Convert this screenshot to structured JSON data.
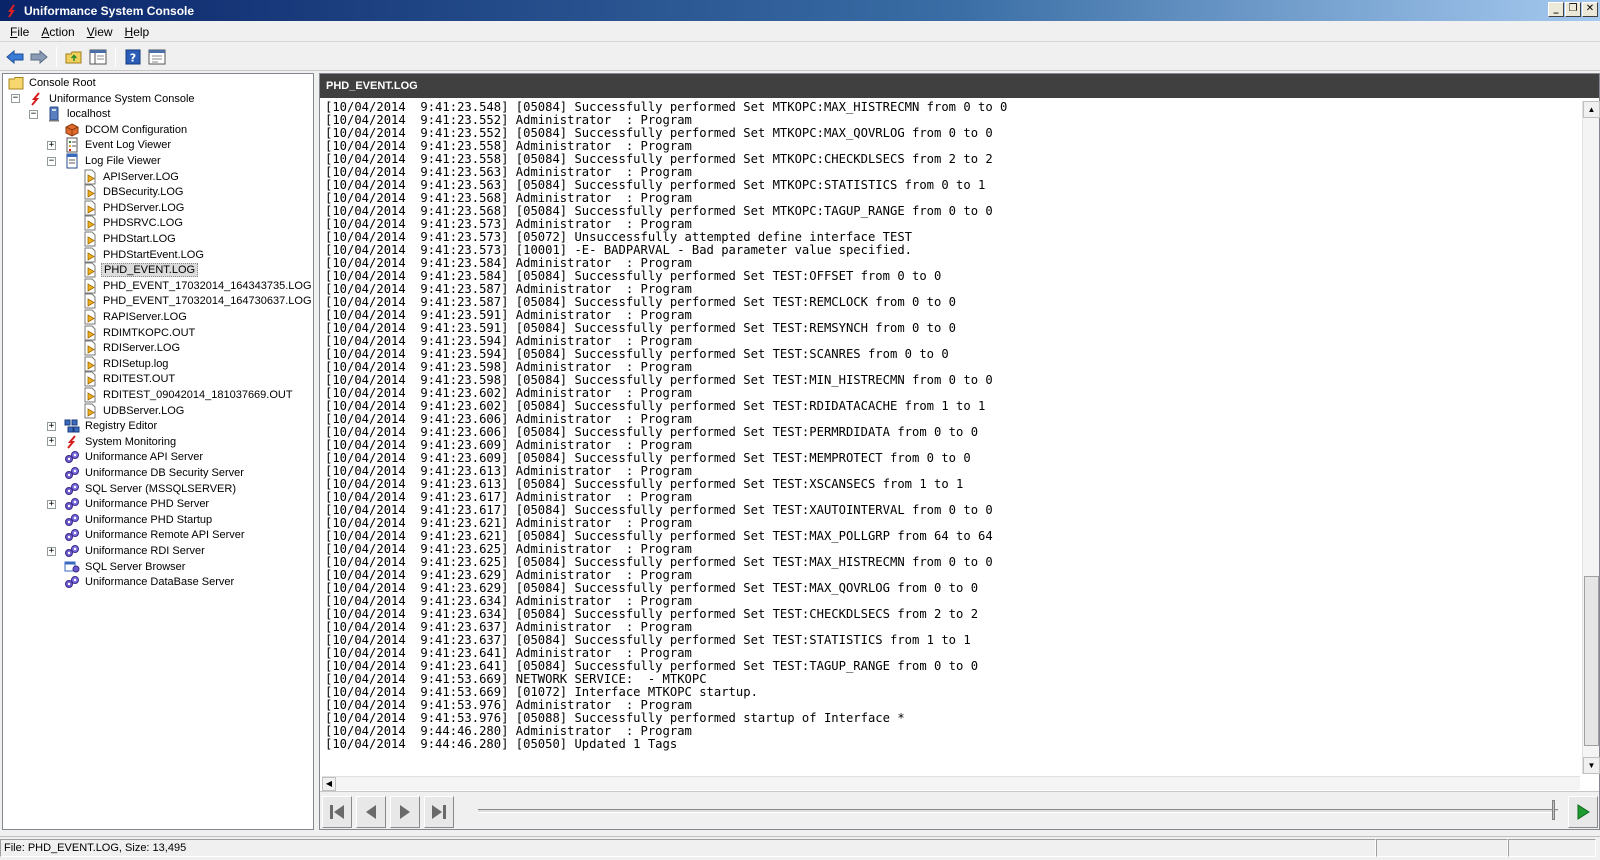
{
  "window": {
    "title": "Uniformance System Console",
    "controls": {
      "minimize": "_",
      "restore": "❐",
      "close": "✕"
    }
  },
  "menu": [
    {
      "label": "File",
      "mnemonic": "F",
      "rest": "ile"
    },
    {
      "label": "Action",
      "mnemonic": "A",
      "rest": "ction"
    },
    {
      "label": "View",
      "mnemonic": "V",
      "rest": "iew"
    },
    {
      "label": "Help",
      "mnemonic": "H",
      "rest": "elp"
    }
  ],
  "toolbar": [
    "back-icon",
    "forward-icon",
    "up-folder-icon",
    "show-hide-tree-icon",
    "help-icon",
    "properties-icon"
  ],
  "tree": [
    {
      "label": "Console Root",
      "icon": "folder-icon",
      "level": 0,
      "expander": ""
    },
    {
      "label": "Uniformance System Console",
      "icon": "uniformance-icon",
      "level": 1,
      "expander": "−"
    },
    {
      "label": "localhost",
      "icon": "computer-icon",
      "level": 2,
      "expander": "−"
    },
    {
      "label": "DCOM Configuration",
      "icon": "dcom-icon",
      "level": 3,
      "expander": ""
    },
    {
      "label": "Event Log Viewer",
      "icon": "event-log-icon",
      "level": 3,
      "expander": "+"
    },
    {
      "label": "Log File Viewer",
      "icon": "log-viewer-icon",
      "level": 3,
      "expander": "−"
    },
    {
      "label": "APIServer.LOG",
      "icon": "log-file-icon",
      "level": 4,
      "expander": ""
    },
    {
      "label": "DBSecurity.LOG",
      "icon": "log-file-icon",
      "level": 4,
      "expander": ""
    },
    {
      "label": "PHDServer.LOG",
      "icon": "log-file-icon",
      "level": 4,
      "expander": ""
    },
    {
      "label": "PHDSRVC.LOG",
      "icon": "log-file-icon",
      "level": 4,
      "expander": ""
    },
    {
      "label": "PHDStart.LOG",
      "icon": "log-file-icon",
      "level": 4,
      "expander": ""
    },
    {
      "label": "PHDStartEvent.LOG",
      "icon": "log-file-icon",
      "level": 4,
      "expander": ""
    },
    {
      "label": "PHD_EVENT.LOG",
      "icon": "log-file-icon",
      "level": 4,
      "expander": "",
      "selected": true
    },
    {
      "label": "PHD_EVENT_17032014_164343735.LOG",
      "icon": "log-file-icon",
      "level": 4,
      "expander": ""
    },
    {
      "label": "PHD_EVENT_17032014_164730637.LOG",
      "icon": "log-file-icon",
      "level": 4,
      "expander": ""
    },
    {
      "label": "RAPIServer.LOG",
      "icon": "log-file-icon",
      "level": 4,
      "expander": ""
    },
    {
      "label": "RDIMTKOPC.OUT",
      "icon": "log-file-icon",
      "level": 4,
      "expander": ""
    },
    {
      "label": "RDIServer.LOG",
      "icon": "log-file-icon",
      "level": 4,
      "expander": ""
    },
    {
      "label": "RDISetup.log",
      "icon": "log-file-icon",
      "level": 4,
      "expander": ""
    },
    {
      "label": "RDITEST.OUT",
      "icon": "log-file-icon",
      "level": 4,
      "expander": ""
    },
    {
      "label": "RDITEST_09042014_181037669.OUT",
      "icon": "log-file-icon",
      "level": 4,
      "expander": ""
    },
    {
      "label": "UDBServer.LOG",
      "icon": "log-file-icon",
      "level": 4,
      "expander": ""
    },
    {
      "label": "Registry Editor",
      "icon": "registry-icon",
      "level": 3,
      "expander": "+"
    },
    {
      "label": "System Monitoring",
      "icon": "uniformance-icon",
      "level": 3,
      "expander": "+"
    },
    {
      "label": "Uniformance API Server",
      "icon": "service-icon",
      "level": 3,
      "expander": ""
    },
    {
      "label": "Uniformance DB Security Server",
      "icon": "service-icon",
      "level": 3,
      "expander": ""
    },
    {
      "label": "SQL Server (MSSQLSERVER)",
      "icon": "service-icon",
      "level": 3,
      "expander": ""
    },
    {
      "label": "Uniformance PHD Server",
      "icon": "service-icon",
      "level": 3,
      "expander": "+"
    },
    {
      "label": "Uniformance PHD Startup",
      "icon": "service-icon",
      "level": 3,
      "expander": ""
    },
    {
      "label": "Uniformance Remote API Server",
      "icon": "service-icon",
      "level": 3,
      "expander": ""
    },
    {
      "label": "Uniformance RDI Server",
      "icon": "service-icon",
      "level": 3,
      "expander": "+"
    },
    {
      "label": "SQL Server Browser",
      "icon": "sql-browser-icon",
      "level": 3,
      "expander": ""
    },
    {
      "label": "Uniformance DataBase Server",
      "icon": "service-icon",
      "level": 3,
      "expander": ""
    }
  ],
  "pane": {
    "title": "PHD_EVENT.LOG",
    "log": [
      "[10/04/2014  9:41:23.548] [05084] Successfully performed Set MTKOPC:MAX_HISTRECMN from 0 to 0",
      "[10/04/2014  9:41:23.552] Administrator  : Program",
      "[10/04/2014  9:41:23.552] [05084] Successfully performed Set MTKOPC:MAX_QOVRLOG from 0 to 0",
      "[10/04/2014  9:41:23.558] Administrator  : Program",
      "[10/04/2014  9:41:23.558] [05084] Successfully performed Set MTKOPC:CHECKDLSECS from 2 to 2",
      "[10/04/2014  9:41:23.563] Administrator  : Program",
      "[10/04/2014  9:41:23.563] [05084] Successfully performed Set MTKOPC:STATISTICS from 0 to 1",
      "[10/04/2014  9:41:23.568] Administrator  : Program",
      "[10/04/2014  9:41:23.568] [05084] Successfully performed Set MTKOPC:TAGUP_RANGE from 0 to 0",
      "[10/04/2014  9:41:23.573] Administrator  : Program",
      "[10/04/2014  9:41:23.573] [05072] Unsuccessfully attempted define interface TEST",
      "[10/04/2014  9:41:23.573] [10001] -E- BADPARVAL - Bad parameter value specified.",
      "[10/04/2014  9:41:23.584] Administrator  : Program",
      "[10/04/2014  9:41:23.584] [05084] Successfully performed Set TEST:OFFSET from 0 to 0",
      "[10/04/2014  9:41:23.587] Administrator  : Program",
      "[10/04/2014  9:41:23.587] [05084] Successfully performed Set TEST:REMCLOCK from 0 to 0",
      "[10/04/2014  9:41:23.591] Administrator  : Program",
      "[10/04/2014  9:41:23.591] [05084] Successfully performed Set TEST:REMSYNCH from 0 to 0",
      "[10/04/2014  9:41:23.594] Administrator  : Program",
      "[10/04/2014  9:41:23.594] [05084] Successfully performed Set TEST:SCANRES from 0 to 0",
      "[10/04/2014  9:41:23.598] Administrator  : Program",
      "[10/04/2014  9:41:23.598] [05084] Successfully performed Set TEST:MIN_HISTRECMN from 0 to 0",
      "[10/04/2014  9:41:23.602] Administrator  : Program",
      "[10/04/2014  9:41:23.602] [05084] Successfully performed Set TEST:RDIDATACACHE from 1 to 1",
      "[10/04/2014  9:41:23.606] Administrator  : Program",
      "[10/04/2014  9:41:23.606] [05084] Successfully performed Set TEST:PERMRDIDATA from 0 to 0",
      "[10/04/2014  9:41:23.609] Administrator  : Program",
      "[10/04/2014  9:41:23.609] [05084] Successfully performed Set TEST:MEMPROTECT from 0 to 0",
      "[10/04/2014  9:41:23.613] Administrator  : Program",
      "[10/04/2014  9:41:23.613] [05084] Successfully performed Set TEST:XSCANSECS from 1 to 1",
      "[10/04/2014  9:41:23.617] Administrator  : Program",
      "[10/04/2014  9:41:23.617] [05084] Successfully performed Set TEST:XAUTOINTERVAL from 0 to 0",
      "[10/04/2014  9:41:23.621] Administrator  : Program",
      "[10/04/2014  9:41:23.621] [05084] Successfully performed Set TEST:MAX_POLLGRP from 64 to 64",
      "[10/04/2014  9:41:23.625] Administrator  : Program",
      "[10/04/2014  9:41:23.625] [05084] Successfully performed Set TEST:MAX_HISTRECMN from 0 to 0",
      "[10/04/2014  9:41:23.629] Administrator  : Program",
      "[10/04/2014  9:41:23.629] [05084] Successfully performed Set TEST:MAX_QOVRLOG from 0 to 0",
      "[10/04/2014  9:41:23.634] Administrator  : Program",
      "[10/04/2014  9:41:23.634] [05084] Successfully performed Set TEST:CHECKDLSECS from 2 to 2",
      "[10/04/2014  9:41:23.637] Administrator  : Program",
      "[10/04/2014  9:41:23.637] [05084] Successfully performed Set TEST:STATISTICS from 1 to 1",
      "[10/04/2014  9:41:23.641] Administrator  : Program",
      "[10/04/2014  9:41:23.641] [05084] Successfully performed Set TEST:TAGUP_RANGE from 0 to 0",
      "[10/04/2014  9:41:53.669] NETWORK SERVICE:  - MTKOPC",
      "[10/04/2014  9:41:53.669] [01072] Interface MTKOPC startup.",
      "[10/04/2014  9:41:53.976] Administrator  : Program",
      "[10/04/2014  9:41:53.976] [05088] Successfully performed startup of Interface *",
      "[10/04/2014  9:44:46.280] Administrator  : Program",
      "[10/04/2014  9:44:46.280] [05050] Updated 1 Tags"
    ]
  },
  "status": {
    "file_info": "File: PHD_EVENT.LOG, Size: 13,495",
    "cell2": "",
    "cell3": ""
  }
}
